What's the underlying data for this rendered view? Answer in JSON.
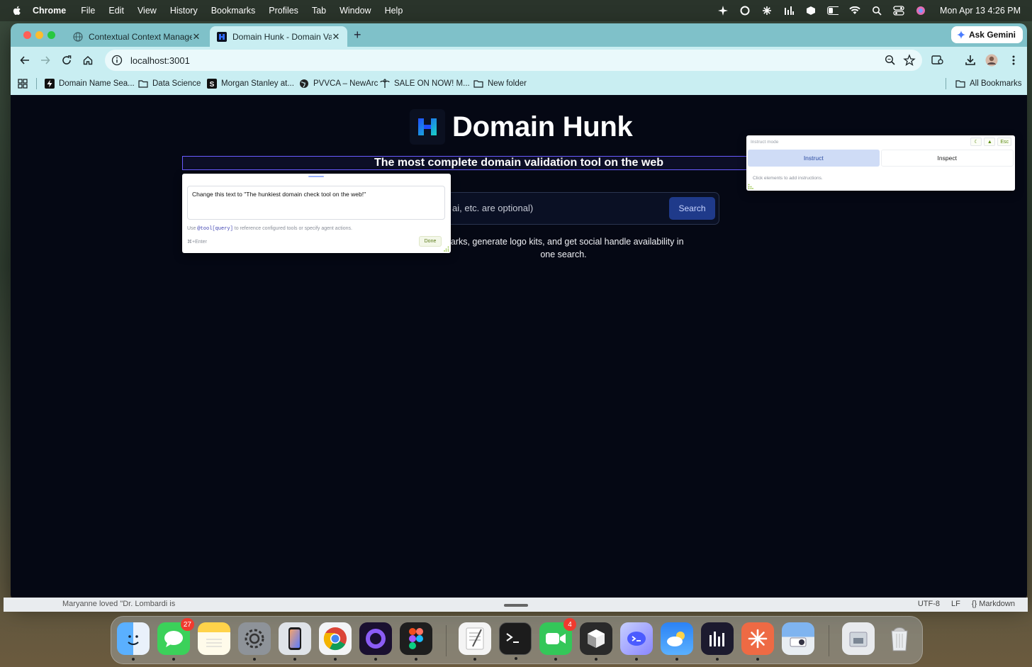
{
  "menubar": {
    "app_name": "Chrome",
    "items": [
      "File",
      "Edit",
      "View",
      "History",
      "Bookmarks",
      "Profiles",
      "Tab",
      "Window",
      "Help"
    ],
    "clock": "Mon Apr 13  4:26 PM"
  },
  "browser": {
    "tabs": [
      {
        "title": "Contextual Context Manager",
        "active": false
      },
      {
        "title": "Domain Hunk - Domain Valida",
        "active": true
      }
    ],
    "ask_gemini_label": "Ask Gemini",
    "url": "localhost:3001",
    "bookmarks": [
      {
        "label": "Domain Name Sea...",
        "icon": "bolt-icon"
      },
      {
        "label": "Data Science",
        "icon": "folder-icon"
      },
      {
        "label": "Morgan Stanley at...",
        "icon": "s-logo-icon"
      },
      {
        "label": "PVVCA – NewArc",
        "icon": "globe-icon"
      },
      {
        "label": "SALE ON NOW! M...",
        "icon": "palm-tree-icon"
      },
      {
        "label": "New folder",
        "icon": "folder-icon"
      }
    ],
    "all_bookmarks_label": "All Bookmarks"
  },
  "page": {
    "brand": "Domain Hunk",
    "tagline": "The most complete domain validation tool on the web",
    "search_placeholder_visible": "ai, etc. are optional)",
    "search_button": "Search",
    "subtext_line1": "marks, generate logo kits, and get social handle availability in",
    "subtext_line2": "one search."
  },
  "instruction_popover": {
    "text": "Change this text to \"The hunkiest domain check tool on the web!\"",
    "hint_prefix": "Use ",
    "hint_code": "@tool[query]",
    "hint_suffix": " to reference configured tools or specify agent actions.",
    "shortcut": "⌘+Enter",
    "done_label": "Done"
  },
  "mode_panel": {
    "title": "Instruct mode",
    "esc_label": "Esc",
    "tabs": [
      {
        "label": "Instruct",
        "active": true
      },
      {
        "label": "Inspect",
        "active": false
      }
    ],
    "empty_text": "Click elements to add instructions."
  },
  "background_app": {
    "notification": "Maryanne loved \"Dr. Lombardi is",
    "status_items": [
      "UTF-8",
      "LF",
      "{} Markdown"
    ]
  },
  "dock": {
    "apps": [
      {
        "name": "Finder",
        "icon": "finder-icon"
      },
      {
        "name": "Messages",
        "icon": "messages-icon",
        "badge": "27"
      },
      {
        "name": "Notes",
        "icon": "notes-icon"
      },
      {
        "name": "System Settings",
        "icon": "settings-icon"
      },
      {
        "name": "iPhone Mirroring",
        "icon": "iphone-icon"
      },
      {
        "name": "Chrome",
        "icon": "chrome-icon"
      },
      {
        "name": "Arc",
        "icon": "ring-icon"
      },
      {
        "name": "Figma",
        "icon": "figma-icon"
      },
      {
        "name": "TextEdit",
        "icon": "textedit-icon"
      },
      {
        "name": "Terminal",
        "icon": "terminal-icon"
      },
      {
        "name": "FaceTime",
        "icon": "facetime-icon",
        "badge": "4"
      },
      {
        "name": "Cube App",
        "icon": "cube-icon"
      },
      {
        "name": "Warp",
        "icon": "warp-icon"
      },
      {
        "name": "Weather",
        "icon": "weather-icon"
      },
      {
        "name": "Bars App",
        "icon": "bars-icon"
      },
      {
        "name": "Claude",
        "icon": "burst-icon"
      },
      {
        "name": "Preview",
        "icon": "preview-icon"
      },
      {
        "name": "Downloads",
        "icon": "downloads-icon"
      },
      {
        "name": "Trash",
        "icon": "trash-icon"
      }
    ]
  },
  "colors": {
    "tabstrip": "#7fc1c9",
    "toolbar": "#c9eef2",
    "page_bg": "#050814",
    "search_button": "#1f3a8a",
    "tagline_outline": "#6a5bff"
  }
}
